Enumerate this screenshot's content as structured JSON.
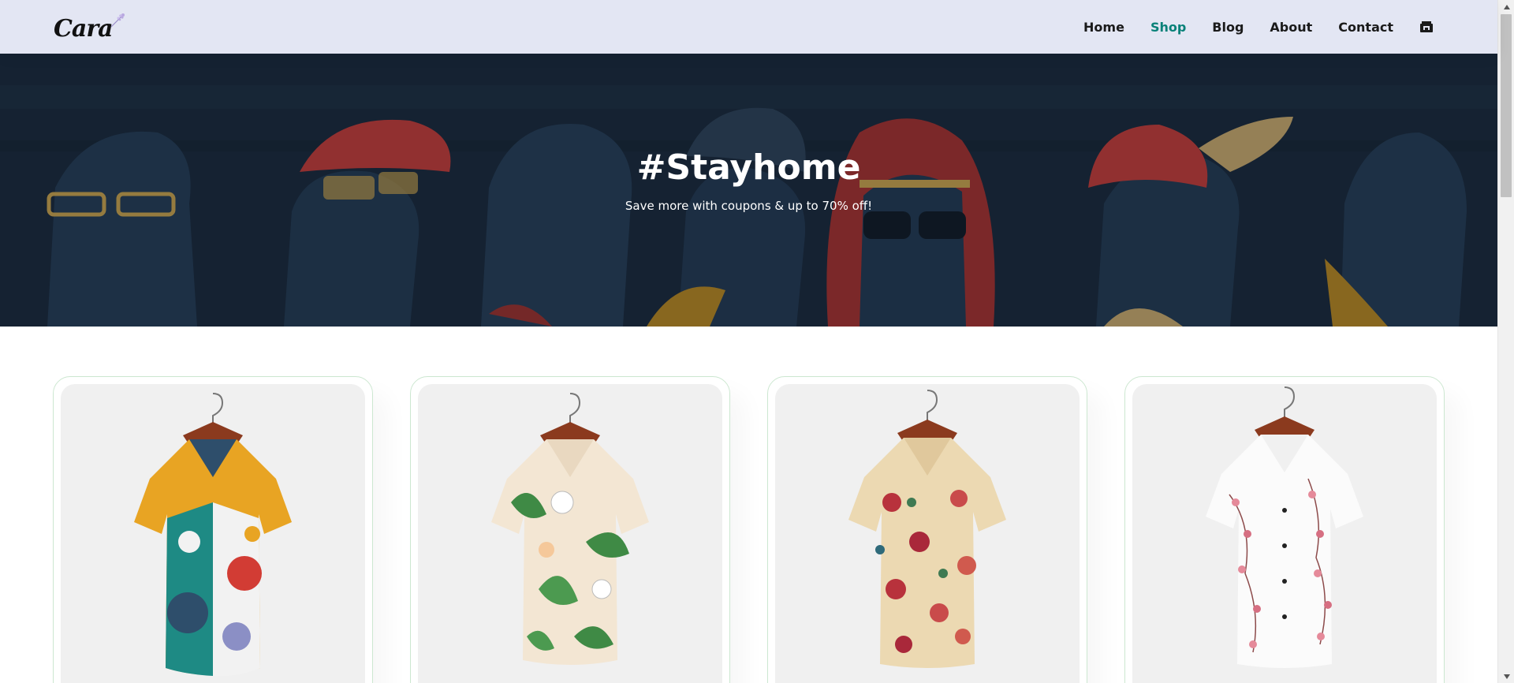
{
  "brand": {
    "logo_text": "Cara",
    "accent": "#088178",
    "header_bg": "#e3e6f3"
  },
  "nav": {
    "items": [
      {
        "label": "Home",
        "active": false
      },
      {
        "label": "Shop",
        "active": true
      },
      {
        "label": "Blog",
        "active": false
      },
      {
        "label": "About",
        "active": false
      },
      {
        "label": "Contact",
        "active": false
      }
    ],
    "cart_icon": "shopping-bag-icon"
  },
  "hero": {
    "title": "#Stayhome",
    "subtitle": "Save more with coupons & up to 70% off!"
  },
  "products": [
    {
      "image": "colorful-abstract-print-shirt"
    },
    {
      "image": "tropical-leaf-floral-shirt"
    },
    {
      "image": "vintage-rose-floral-shirt"
    },
    {
      "image": "pink-blossom-white-shirt"
    }
  ]
}
